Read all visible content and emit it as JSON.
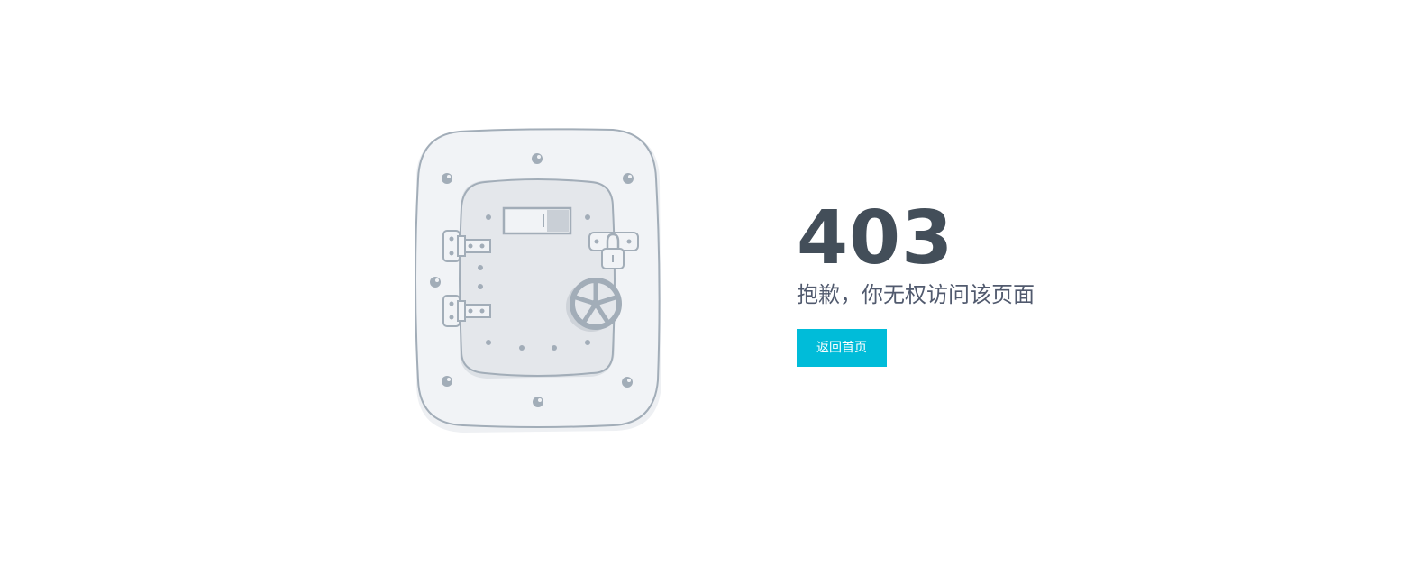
{
  "error": {
    "code": "403",
    "message": "抱歉，你无权访问该页面"
  },
  "actions": {
    "home_label": "返回首页"
  },
  "colors": {
    "primary": "#00bcd9",
    "heading": "#434e59",
    "text": "#515a6e"
  },
  "illustration": {
    "icon": "locked-vault-door-icon"
  }
}
